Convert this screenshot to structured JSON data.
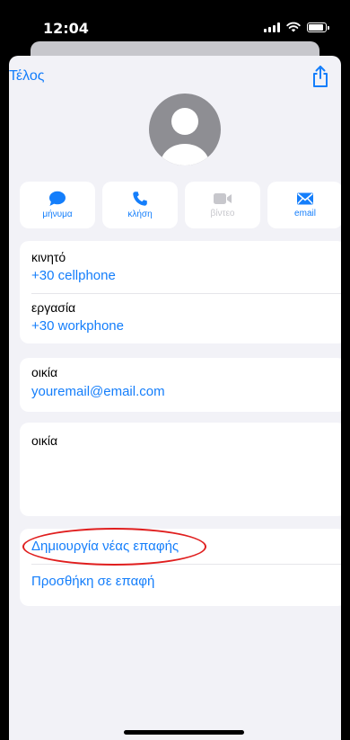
{
  "status": {
    "time": "12:04"
  },
  "nav": {
    "done_label": "Τέλος"
  },
  "actions": {
    "message": "μήνυμα",
    "call": "κλήση",
    "video": "βίντεο",
    "email": "email"
  },
  "phones": {
    "mobile_label": "κινητό",
    "mobile_value": "+30 cellphone",
    "work_label": "εργασία",
    "work_value": "+30 workphone"
  },
  "email": {
    "label": "οικία",
    "value": "youremail@email.com"
  },
  "address": {
    "label": "οικία"
  },
  "links": {
    "create_new": "Δημιουργία νέας επαφής",
    "add_existing": "Προσθήκη σε επαφή"
  },
  "colors": {
    "accent": "#147efb",
    "annotation": "#e01e1e"
  }
}
